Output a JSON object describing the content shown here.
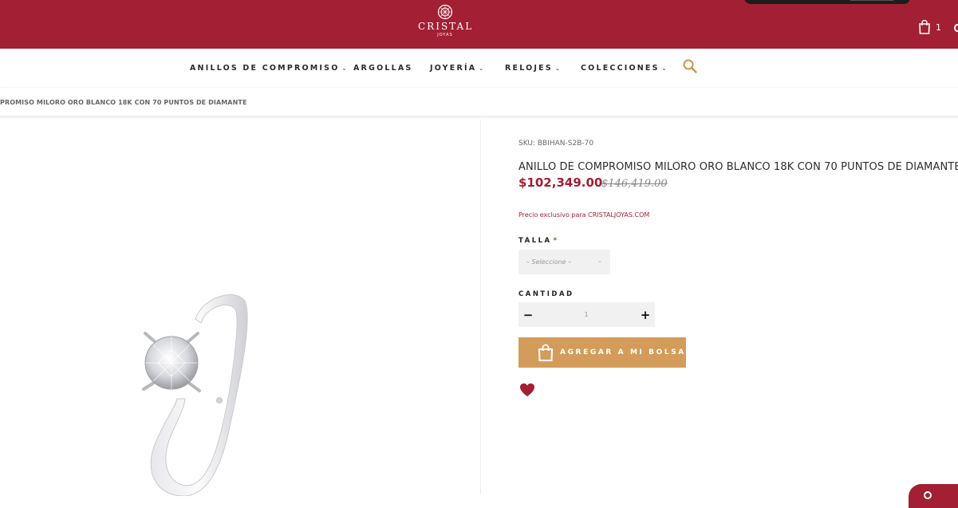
{
  "brand": {
    "name": "CRISTAL",
    "sub": "JOYAS"
  },
  "cart": {
    "count": "1",
    "icon": "shopping-bag-icon"
  },
  "nav": {
    "items": [
      {
        "label": "ANILLOS DE COMPROMISO",
        "has_dropdown": true
      },
      {
        "label": "ARGOLLAS",
        "has_dropdown": false
      },
      {
        "label": "JOYERÍA",
        "has_dropdown": true
      },
      {
        "label": "RELOJES",
        "has_dropdown": true
      },
      {
        "label": "COLECCIONES",
        "has_dropdown": true
      }
    ],
    "search_icon": "search-icon"
  },
  "breadcrumb": {
    "text": "PROMISO MILORO ORO BLANCO 18K CON 70 PUNTOS DE DIAMANTE"
  },
  "product": {
    "sku": "SKU: BBIHAN-S2B-70",
    "title": "ANILLO DE COMPROMISO MILORO ORO BLANCO 18K CON 70 PUNTOS DE DIAMANTE",
    "price": "$102,349.00",
    "old_price": "$146,419.00",
    "exclusive_note": "Precio exclusivo para CRISTALJOYAS.COM"
  },
  "size": {
    "label": "TALLA",
    "required_mark": "*",
    "selected": "– Seleccione –"
  },
  "quantity": {
    "label": "CANTIDAD",
    "minus": "−",
    "plus": "+",
    "value": "1"
  },
  "add_to_bag": {
    "label": "AGREGAR A MI BOLSA",
    "icon": "shopping-bag-icon"
  },
  "wishlist": {
    "icon": "heart-icon"
  },
  "colors": {
    "brand_red": "#a31f33",
    "button_gold": "#d49c5a",
    "search_gold": "#c9964f"
  }
}
